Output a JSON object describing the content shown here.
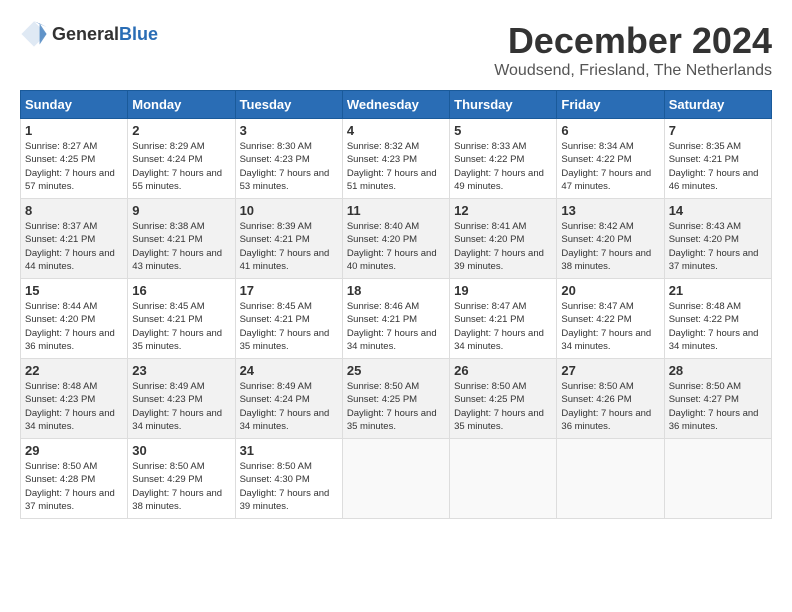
{
  "header": {
    "logo_general": "General",
    "logo_blue": "Blue",
    "title": "December 2024",
    "subtitle": "Woudsend, Friesland, The Netherlands"
  },
  "calendar": {
    "columns": [
      "Sunday",
      "Monday",
      "Tuesday",
      "Wednesday",
      "Thursday",
      "Friday",
      "Saturday"
    ],
    "weeks": [
      [
        {
          "day": "1",
          "sunrise": "8:27 AM",
          "sunset": "4:25 PM",
          "daylight": "7 hours and 57 minutes."
        },
        {
          "day": "2",
          "sunrise": "8:29 AM",
          "sunset": "4:24 PM",
          "daylight": "7 hours and 55 minutes."
        },
        {
          "day": "3",
          "sunrise": "8:30 AM",
          "sunset": "4:23 PM",
          "daylight": "7 hours and 53 minutes."
        },
        {
          "day": "4",
          "sunrise": "8:32 AM",
          "sunset": "4:23 PM",
          "daylight": "7 hours and 51 minutes."
        },
        {
          "day": "5",
          "sunrise": "8:33 AM",
          "sunset": "4:22 PM",
          "daylight": "7 hours and 49 minutes."
        },
        {
          "day": "6",
          "sunrise": "8:34 AM",
          "sunset": "4:22 PM",
          "daylight": "7 hours and 47 minutes."
        },
        {
          "day": "7",
          "sunrise": "8:35 AM",
          "sunset": "4:21 PM",
          "daylight": "7 hours and 46 minutes."
        }
      ],
      [
        {
          "day": "8",
          "sunrise": "8:37 AM",
          "sunset": "4:21 PM",
          "daylight": "7 hours and 44 minutes."
        },
        {
          "day": "9",
          "sunrise": "8:38 AM",
          "sunset": "4:21 PM",
          "daylight": "7 hours and 43 minutes."
        },
        {
          "day": "10",
          "sunrise": "8:39 AM",
          "sunset": "4:21 PM",
          "daylight": "7 hours and 41 minutes."
        },
        {
          "day": "11",
          "sunrise": "8:40 AM",
          "sunset": "4:20 PM",
          "daylight": "7 hours and 40 minutes."
        },
        {
          "day": "12",
          "sunrise": "8:41 AM",
          "sunset": "4:20 PM",
          "daylight": "7 hours and 39 minutes."
        },
        {
          "day": "13",
          "sunrise": "8:42 AM",
          "sunset": "4:20 PM",
          "daylight": "7 hours and 38 minutes."
        },
        {
          "day": "14",
          "sunrise": "8:43 AM",
          "sunset": "4:20 PM",
          "daylight": "7 hours and 37 minutes."
        }
      ],
      [
        {
          "day": "15",
          "sunrise": "8:44 AM",
          "sunset": "4:20 PM",
          "daylight": "7 hours and 36 minutes."
        },
        {
          "day": "16",
          "sunrise": "8:45 AM",
          "sunset": "4:21 PM",
          "daylight": "7 hours and 35 minutes."
        },
        {
          "day": "17",
          "sunrise": "8:45 AM",
          "sunset": "4:21 PM",
          "daylight": "7 hours and 35 minutes."
        },
        {
          "day": "18",
          "sunrise": "8:46 AM",
          "sunset": "4:21 PM",
          "daylight": "7 hours and 34 minutes."
        },
        {
          "day": "19",
          "sunrise": "8:47 AM",
          "sunset": "4:21 PM",
          "daylight": "7 hours and 34 minutes."
        },
        {
          "day": "20",
          "sunrise": "8:47 AM",
          "sunset": "4:22 PM",
          "daylight": "7 hours and 34 minutes."
        },
        {
          "day": "21",
          "sunrise": "8:48 AM",
          "sunset": "4:22 PM",
          "daylight": "7 hours and 34 minutes."
        }
      ],
      [
        {
          "day": "22",
          "sunrise": "8:48 AM",
          "sunset": "4:23 PM",
          "daylight": "7 hours and 34 minutes."
        },
        {
          "day": "23",
          "sunrise": "8:49 AM",
          "sunset": "4:23 PM",
          "daylight": "7 hours and 34 minutes."
        },
        {
          "day": "24",
          "sunrise": "8:49 AM",
          "sunset": "4:24 PM",
          "daylight": "7 hours and 34 minutes."
        },
        {
          "day": "25",
          "sunrise": "8:50 AM",
          "sunset": "4:25 PM",
          "daylight": "7 hours and 35 minutes."
        },
        {
          "day": "26",
          "sunrise": "8:50 AM",
          "sunset": "4:25 PM",
          "daylight": "7 hours and 35 minutes."
        },
        {
          "day": "27",
          "sunrise": "8:50 AM",
          "sunset": "4:26 PM",
          "daylight": "7 hours and 36 minutes."
        },
        {
          "day": "28",
          "sunrise": "8:50 AM",
          "sunset": "4:27 PM",
          "daylight": "7 hours and 36 minutes."
        }
      ],
      [
        {
          "day": "29",
          "sunrise": "8:50 AM",
          "sunset": "4:28 PM",
          "daylight": "7 hours and 37 minutes."
        },
        {
          "day": "30",
          "sunrise": "8:50 AM",
          "sunset": "4:29 PM",
          "daylight": "7 hours and 38 minutes."
        },
        {
          "day": "31",
          "sunrise": "8:50 AM",
          "sunset": "4:30 PM",
          "daylight": "7 hours and 39 minutes."
        },
        null,
        null,
        null,
        null
      ]
    ],
    "labels": {
      "sunrise": "Sunrise:",
      "sunset": "Sunset:",
      "daylight": "Daylight:"
    }
  }
}
